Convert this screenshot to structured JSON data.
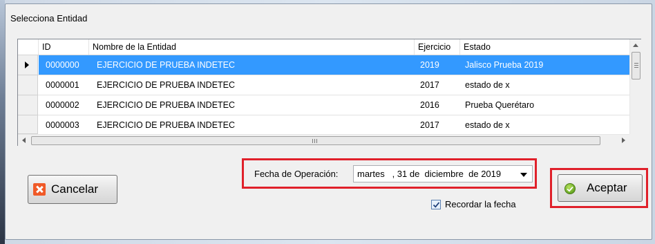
{
  "window": {
    "title": "Selecciona Entidad"
  },
  "grid": {
    "columns": [
      "ID",
      "Nombre de la Entidad",
      "Ejercicio",
      "Estado"
    ],
    "rows": [
      {
        "id": "0000000",
        "name": "EJERCICIO DE PRUEBA INDETEC",
        "ejercicio": "2019",
        "estado": "Jalisco Prueba 2019",
        "selected": true
      },
      {
        "id": "0000001",
        "name": "EJERCICIO DE PRUEBA INDETEC",
        "ejercicio": "2017",
        "estado": "estado de x",
        "selected": false
      },
      {
        "id": "0000002",
        "name": "EJERCICIO DE PRUEBA INDETEC",
        "ejercicio": "2016",
        "estado": "Prueba Querétaro",
        "selected": false
      },
      {
        "id": "0000003",
        "name": "EJERCICIO DE PRUEBA INDETEC",
        "ejercicio": "2017",
        "estado": "estado de x",
        "selected": false
      }
    ]
  },
  "date": {
    "label": "Fecha de Operación:",
    "value": "martes   , 31 de  diciembre  de 2019"
  },
  "remember": {
    "label": "Recordar la fecha",
    "checked": true
  },
  "buttons": {
    "cancel": "Cancelar",
    "accept": "Aceptar"
  },
  "icons": {
    "cancel": "close-x-icon",
    "accept": "check-circle-icon",
    "row_selector": "row-pointer-icon",
    "checkbox": "checkmark-icon"
  },
  "colors": {
    "selection": "#3399ff",
    "highlight_border": "#e0202a",
    "cancel_icon": "#f05a28",
    "accept_icon": "#5c9e1c"
  }
}
